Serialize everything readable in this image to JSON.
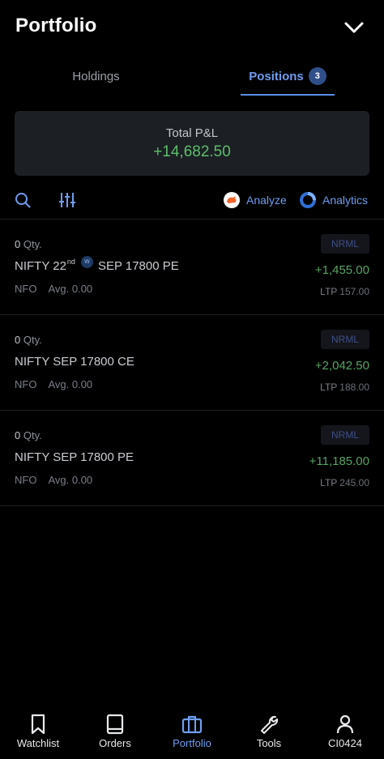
{
  "header": {
    "title": "Portfolio",
    "collapse_icon": "chevron-down-icon"
  },
  "tabs": [
    {
      "label": "Holdings",
      "active": false
    },
    {
      "label": "Positions",
      "active": true,
      "badge": "3"
    }
  ],
  "summary": {
    "label": "Total P&L",
    "value": "+14,682.50"
  },
  "toolbar": {
    "search_icon": "search-icon",
    "filter_icon": "filter-sliders-icon",
    "analyze_label": "Analyze",
    "analytics_label": "Analytics"
  },
  "positions": [
    {
      "qty": "0",
      "qty_suffix": " Qty.",
      "name_prefix": "NIFTY 22",
      "name_sup": "nd",
      "weekly_badge": "W",
      "name_suffix": "SEP 17800 PE",
      "exchange": "NFO",
      "avg_label": "Avg.",
      "avg_value": "0.00",
      "product": "NRML",
      "pnl": "+1,455.00",
      "ltp_label": "LTP",
      "ltp_value": "157.00"
    },
    {
      "qty": "0",
      "qty_suffix": " Qty.",
      "name": "NIFTY SEP 17800 CE",
      "exchange": "NFO",
      "avg_label": "Avg.",
      "avg_value": "0.00",
      "product": "NRML",
      "pnl": "+2,042.50",
      "ltp_label": "LTP",
      "ltp_value": "188.00"
    },
    {
      "qty": "0",
      "qty_suffix": " Qty.",
      "name": "NIFTY SEP 17800 PE",
      "exchange": "NFO",
      "avg_label": "Avg.",
      "avg_value": "0.00",
      "product": "NRML",
      "pnl": "+11,185.00",
      "ltp_label": "LTP",
      "ltp_value": "245.00"
    }
  ],
  "bottom_nav": [
    {
      "label": "Watchlist",
      "icon": "bookmark-icon",
      "active": false
    },
    {
      "label": "Orders",
      "icon": "book-icon",
      "active": false
    },
    {
      "label": "Portfolio",
      "icon": "briefcase-icon",
      "active": true
    },
    {
      "label": "Tools",
      "icon": "wrench-icon",
      "active": false
    },
    {
      "label": "CI0424",
      "icon": "user-icon",
      "active": false
    }
  ],
  "colors": {
    "background": "#000000",
    "accent": "#6f9cf0",
    "profit": "#5cbf6a",
    "card": "#1c1f24"
  }
}
